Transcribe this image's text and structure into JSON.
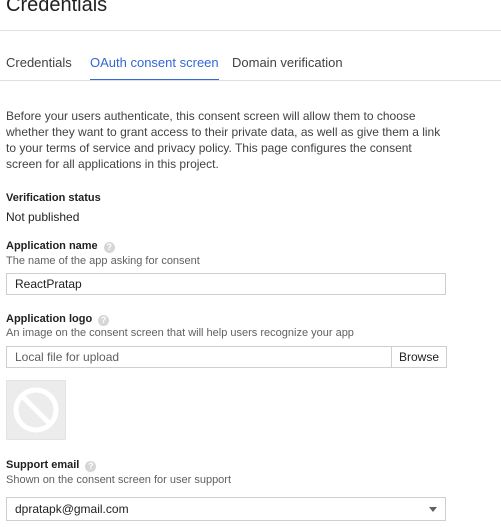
{
  "page": {
    "title": "Credentials"
  },
  "tabs": [
    {
      "label": "Credentials",
      "active": false
    },
    {
      "label": "OAuth consent screen",
      "active": true
    },
    {
      "label": "Domain verification",
      "active": false
    }
  ],
  "intro": "Before your users authenticate, this consent screen will allow them to choose whether they want to grant access to their private data, as well as give them a link to your terms of service and privacy policy. This page configures the consent screen for all applications in this project.",
  "verification": {
    "label": "Verification status",
    "value": "Not published"
  },
  "app_name": {
    "label": "Application name",
    "description": "The name of the app asking for consent",
    "value": "ReactPratap"
  },
  "app_logo": {
    "label": "Application logo",
    "description": "An image on the consent screen that will help users recognize your app",
    "placeholder": "Local file for upload",
    "browse_label": "Browse"
  },
  "support_email": {
    "label": "Support email",
    "description": "Shown on the consent screen for user support",
    "value": "dpratapk@gmail.com"
  },
  "colors": {
    "accent": "#3367d6",
    "border": "#cfcfcf"
  },
  "icons": [
    "help-icon",
    "no-image-icon",
    "dropdown-caret-icon"
  ]
}
